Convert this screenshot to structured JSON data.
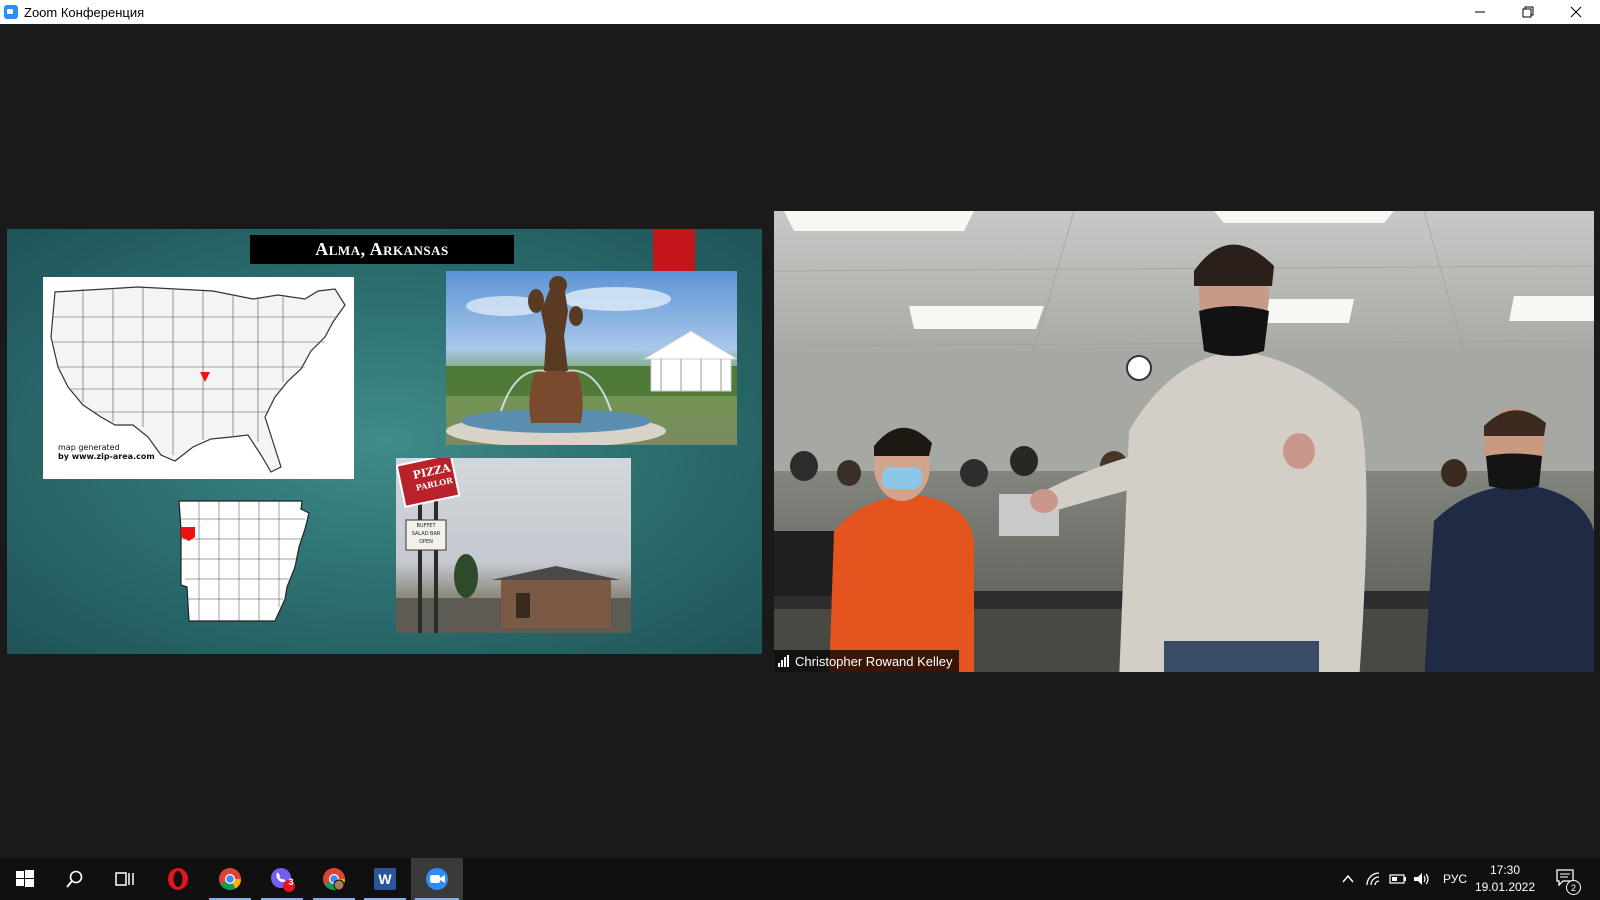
{
  "window": {
    "title": "Zoom Конференция",
    "controls": {
      "minimize": "—",
      "restore": "❐",
      "close": "✕"
    }
  },
  "slide": {
    "title": "Alma, Arkansas",
    "us_map_caption_line1": "map generated",
    "us_map_caption_line2": "by www.zip-area.com",
    "sign_text_top": "PIZZA",
    "sign_text_bottom": "PARLOR",
    "sign_board_lines": [
      "BUFFET",
      "SALAD BAR",
      "OPEN"
    ],
    "accent_color": "#c4151b"
  },
  "video": {
    "participant_name": "Christopher Rowand Kelley",
    "signal_icon": "signal-bars-icon"
  },
  "taskbar": {
    "apps": [
      {
        "name": "start",
        "icon": "windows-icon"
      },
      {
        "name": "search",
        "icon": "search-icon"
      },
      {
        "name": "task-view",
        "icon": "task-view-icon"
      },
      {
        "name": "opera",
        "icon": "opera-icon"
      },
      {
        "name": "chrome",
        "icon": "chrome-icon"
      },
      {
        "name": "viber",
        "icon": "viber-icon",
        "badge": "3"
      },
      {
        "name": "chrome-profile",
        "icon": "chrome-profile-icon"
      },
      {
        "name": "word",
        "icon": "word-icon",
        "letter": "W"
      },
      {
        "name": "zoom",
        "icon": "zoom-icon"
      }
    ],
    "language": "РУС",
    "time": "17:30",
    "date": "19.01.2022",
    "notifications_count": "2"
  }
}
